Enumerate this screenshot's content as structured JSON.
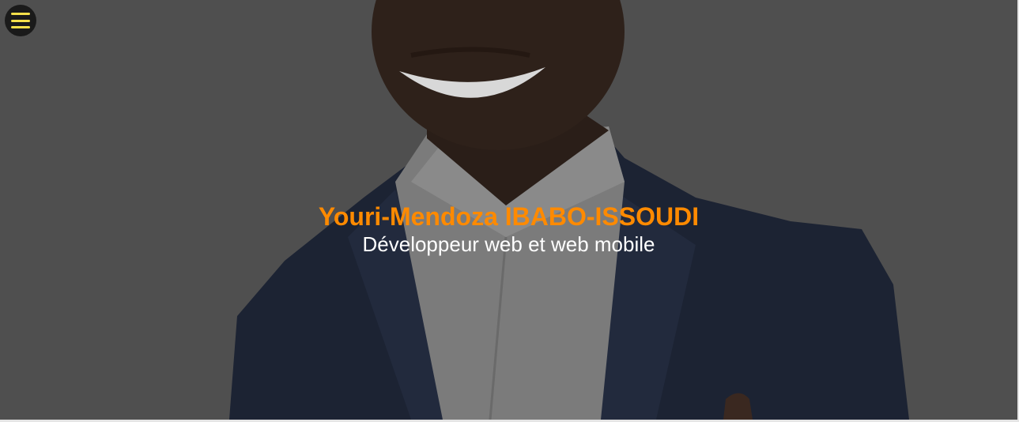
{
  "menu": {
    "icon": "hamburger-menu-icon",
    "icon_color": "#f5e04a",
    "background_color": "#1a1a1a"
  },
  "hero": {
    "name": "Youri-Mendoza IBABO-ISSOUDI",
    "role": "Développeur web et web mobile",
    "name_color": "#ff8a00",
    "role_color": "#ffffff",
    "overlay_color": "#4f4f4f"
  }
}
